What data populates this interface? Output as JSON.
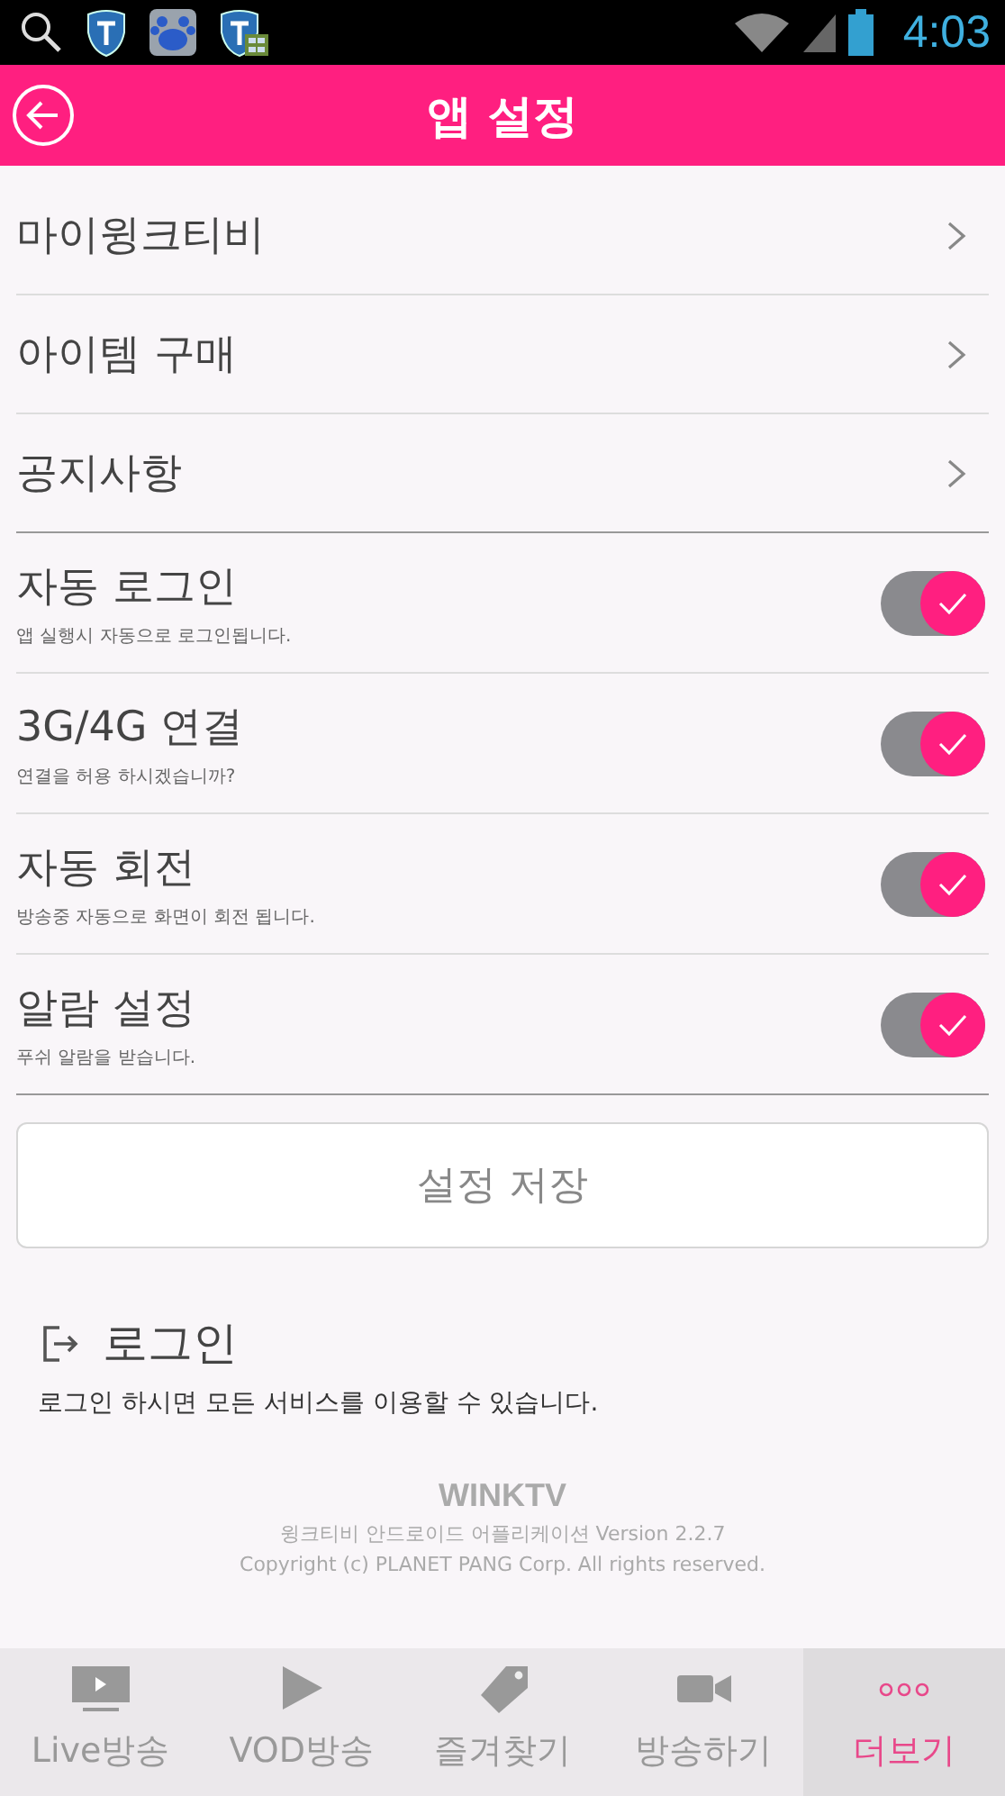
{
  "status_bar": {
    "time": "4:03"
  },
  "header": {
    "title": "앱 설정"
  },
  "menu": [
    {
      "label": "마이윙크티비"
    },
    {
      "label": "아이템 구매"
    },
    {
      "label": "공지사항"
    }
  ],
  "settings": [
    {
      "label": "자동 로그인",
      "description": "앱 실행시 자동으로 로그인됩니다.",
      "on": true
    },
    {
      "label": "3G/4G 연결",
      "description": "연결을 허용 하시겠습니까?",
      "on": true
    },
    {
      "label": "자동 회전",
      "description": "방송중 자동으로 화면이 회전 됩니다.",
      "on": true
    },
    {
      "label": "알람 설정",
      "description": "푸쉬 알람을 받습니다.",
      "on": true
    }
  ],
  "save_button": "설정 저장",
  "login": {
    "title": "로그인",
    "description": "로그인 하시면 모든 서비스를 이용할 수 있습니다."
  },
  "footer": {
    "logo": "WINKTV",
    "version": "윙크티비 안드로이드 어플리케이션 Version 2.2.7",
    "copyright": "Copyright (c) PLANET PANG Corp. All rights reserved."
  },
  "nav": [
    {
      "kind": "tv",
      "label": "Live방송",
      "selected": false
    },
    {
      "kind": "play",
      "label": "VOD방송",
      "selected": false
    },
    {
      "kind": "tag",
      "label": "즐겨찾기",
      "selected": false
    },
    {
      "kind": "camera",
      "label": "방송하기",
      "selected": false
    },
    {
      "kind": "more",
      "label": "더보기",
      "selected": true
    }
  ]
}
